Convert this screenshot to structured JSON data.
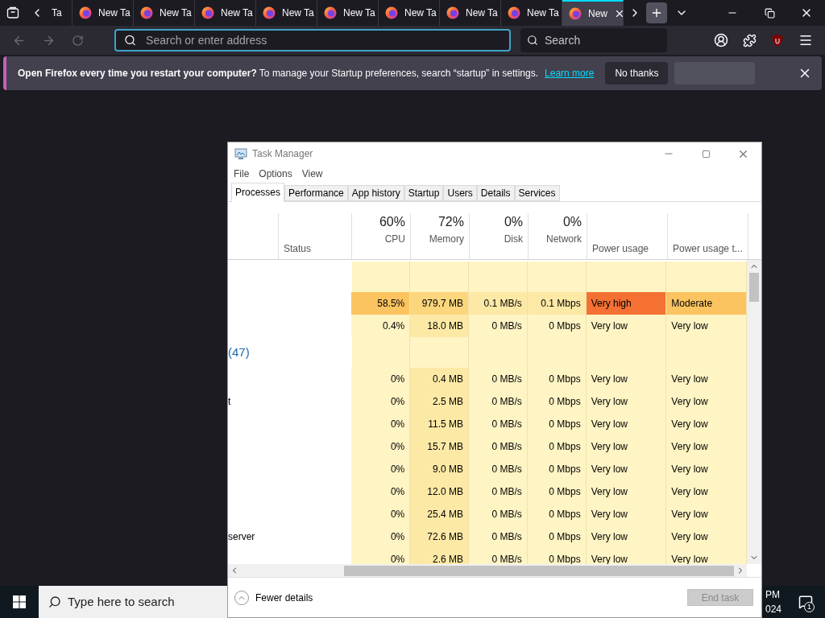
{
  "browser": {
    "tabs": [
      {
        "label": "Ta",
        "selected": false
      },
      {
        "label": "New Ta",
        "selected": false
      },
      {
        "label": "New Ta",
        "selected": false
      },
      {
        "label": "New Ta",
        "selected": false
      },
      {
        "label": "New Ta",
        "selected": false
      },
      {
        "label": "New Ta",
        "selected": false
      },
      {
        "label": "New Ta",
        "selected": false
      },
      {
        "label": "New Ta",
        "selected": false
      },
      {
        "label": "New Ta",
        "selected": false
      },
      {
        "label": "New",
        "selected": true
      }
    ],
    "address": {
      "placeholder": "Search or enter address"
    },
    "search": {
      "placeholder": "Search"
    },
    "notification": {
      "message": "**Open Firefox every time you restart your computer?** To manage your Startup preferences, search “startup” in settings.",
      "link": "Learn more",
      "buttons": [
        "No thanks"
      ]
    }
  },
  "task_manager": {
    "title": "Task Manager",
    "menu": [
      "File",
      "Options",
      "View"
    ],
    "tabs": [
      {
        "label": "Processes",
        "selected": true
      },
      {
        "label": "Performance",
        "selected": false
      },
      {
        "label": "App history",
        "selected": false
      },
      {
        "label": "Startup",
        "selected": false
      },
      {
        "label": "Users",
        "selected": false
      },
      {
        "label": "Details",
        "selected": false
      },
      {
        "label": "Services",
        "selected": false
      }
    ],
    "columns": [
      {
        "label": "Status"
      },
      {
        "label": "CPU",
        "total": "60%"
      },
      {
        "label": "Memory",
        "total": "72%"
      },
      {
        "label": "Disk",
        "total": "0%"
      },
      {
        "label": "Network",
        "total": "0%"
      },
      {
        "label": "Power usage"
      },
      {
        "label": "Power usage t..."
      }
    ],
    "rows": [
      {
        "kind": "blank"
      },
      {
        "kind": "process",
        "cells": [
          {
            "text": "58.5%",
            "color": "#fbc460"
          },
          {
            "text": "979.7 MB",
            "color": "#fcd67c"
          },
          {
            "text": "0.1 MB/s",
            "color": "#fde9a6"
          },
          {
            "text": "0.1 Mbps",
            "color": "#fde9a6"
          },
          {
            "text": "Very high",
            "color": "#f47133"
          },
          {
            "text": "Moderate",
            "color": "#fbc460"
          }
        ]
      },
      {
        "kind": "process",
        "cells": [
          {
            "text": "0.4%",
            "color": "#fff4c4"
          },
          {
            "text": "18.0 MB",
            "color": "#fde9a6"
          },
          {
            "text": "0 MB/s",
            "color": "#fff4c4"
          },
          {
            "text": "0 Mbps",
            "color": "#fff4c4"
          },
          {
            "text": "Very low",
            "color": "#fff4c4"
          },
          {
            "text": "Very low",
            "color": "#fff4c4"
          }
        ]
      },
      {
        "kind": "group",
        "name": "(47)"
      },
      {
        "kind": "process",
        "cells": [
          {
            "text": "0%",
            "color": "#fff4c4"
          },
          {
            "text": "0.4 MB",
            "color": "#fde9a6"
          },
          {
            "text": "0 MB/s",
            "color": "#fff4c4"
          },
          {
            "text": "0 Mbps",
            "color": "#fff4c4"
          },
          {
            "text": "Very low",
            "color": "#fff4c4"
          },
          {
            "text": "Very low",
            "color": "#fff4c4"
          }
        ]
      },
      {
        "kind": "process",
        "name": "t",
        "cells": [
          {
            "text": "0%",
            "color": "#fff4c4"
          },
          {
            "text": "2.5 MB",
            "color": "#fde9a6"
          },
          {
            "text": "0 MB/s",
            "color": "#fff4c4"
          },
          {
            "text": "0 Mbps",
            "color": "#fff4c4"
          },
          {
            "text": "Very low",
            "color": "#fff4c4"
          },
          {
            "text": "Very low",
            "color": "#fff4c4"
          }
        ]
      },
      {
        "kind": "process",
        "cells": [
          {
            "text": "0%",
            "color": "#fff4c4"
          },
          {
            "text": "11.5 MB",
            "color": "#fde9a6"
          },
          {
            "text": "0 MB/s",
            "color": "#fff4c4"
          },
          {
            "text": "0 Mbps",
            "color": "#fff4c4"
          },
          {
            "text": "Very low",
            "color": "#fff4c4"
          },
          {
            "text": "Very low",
            "color": "#fff4c4"
          }
        ]
      },
      {
        "kind": "process",
        "cells": [
          {
            "text": "0%",
            "color": "#fff4c4"
          },
          {
            "text": "15.7 MB",
            "color": "#fde9a6"
          },
          {
            "text": "0 MB/s",
            "color": "#fff4c4"
          },
          {
            "text": "0 Mbps",
            "color": "#fff4c4"
          },
          {
            "text": "Very low",
            "color": "#fff4c4"
          },
          {
            "text": "Very low",
            "color": "#fff4c4"
          }
        ]
      },
      {
        "kind": "process",
        "cells": [
          {
            "text": "0%",
            "color": "#fff4c4"
          },
          {
            "text": "9.0 MB",
            "color": "#fde9a6"
          },
          {
            "text": "0 MB/s",
            "color": "#fff4c4"
          },
          {
            "text": "0 Mbps",
            "color": "#fff4c4"
          },
          {
            "text": "Very low",
            "color": "#fff4c4"
          },
          {
            "text": "Very low",
            "color": "#fff4c4"
          }
        ]
      },
      {
        "kind": "process",
        "cells": [
          {
            "text": "0%",
            "color": "#fff4c4"
          },
          {
            "text": "12.0 MB",
            "color": "#fde9a6"
          },
          {
            "text": "0 MB/s",
            "color": "#fff4c4"
          },
          {
            "text": "0 Mbps",
            "color": "#fff4c4"
          },
          {
            "text": "Very low",
            "color": "#fff4c4"
          },
          {
            "text": "Very low",
            "color": "#fff4c4"
          }
        ]
      },
      {
        "kind": "process",
        "cells": [
          {
            "text": "0%",
            "color": "#fff4c4"
          },
          {
            "text": "25.4 MB",
            "color": "#fde9a6"
          },
          {
            "text": "0 MB/s",
            "color": "#fff4c4"
          },
          {
            "text": "0 Mbps",
            "color": "#fff4c4"
          },
          {
            "text": "Very low",
            "color": "#fff4c4"
          },
          {
            "text": "Very low",
            "color": "#fff4c4"
          }
        ]
      },
      {
        "kind": "process",
        "name": "server",
        "cells": [
          {
            "text": "0%",
            "color": "#fff4c4"
          },
          {
            "text": "72.6 MB",
            "color": "#fde9a6"
          },
          {
            "text": "0 MB/s",
            "color": "#fff4c4"
          },
          {
            "text": "0 Mbps",
            "color": "#fff4c4"
          },
          {
            "text": "Very low",
            "color": "#fff4c4"
          },
          {
            "text": "Very low",
            "color": "#fff4c4"
          }
        ]
      },
      {
        "kind": "process",
        "cells": [
          {
            "text": "0%",
            "color": "#fff4c4"
          },
          {
            "text": "2.6 MB",
            "color": "#fde9a6"
          },
          {
            "text": "0 MB/s",
            "color": "#fff4c4"
          },
          {
            "text": "0 Mbps",
            "color": "#fff4c4"
          },
          {
            "text": "Very low",
            "color": "#fff4c4"
          },
          {
            "text": "Very low",
            "color": "#fff4c4"
          }
        ]
      }
    ],
    "footer": {
      "toggle": "Fewer details",
      "end_task": {
        "label": "End task",
        "disabled": true
      }
    }
  },
  "taskbar": {
    "search": {
      "placeholder": "Type here to search"
    },
    "clock": [
      "PM",
      "024"
    ],
    "notifications": "1"
  }
}
